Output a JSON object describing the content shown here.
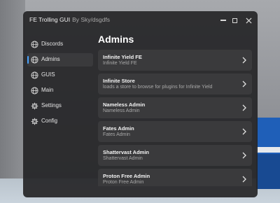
{
  "window": {
    "title": "FE Trolling GUI",
    "subtitle": "By Sky/dsgdfs"
  },
  "sidebar": {
    "items": [
      {
        "label": "Discords",
        "icon": "globe-icon",
        "active": false
      },
      {
        "label": "Admins",
        "icon": "globe-icon",
        "active": true
      },
      {
        "label": "GUIS",
        "icon": "globe-icon",
        "active": false
      },
      {
        "label": "Main",
        "icon": "globe-icon",
        "active": false
      },
      {
        "label": "Settings",
        "icon": "gear-icon",
        "active": false
      },
      {
        "label": "Config",
        "icon": "gear-icon",
        "active": false
      }
    ]
  },
  "main": {
    "title": "Admins",
    "cards": [
      {
        "title": "Infinite Yield FE",
        "desc": "Infinite Yield FE"
      },
      {
        "title": "Infinite Store",
        "desc": "loads a store to browse for plugins for Infinite Yield"
      },
      {
        "title": "Nameless Admin",
        "desc": "Nameless Admin"
      },
      {
        "title": "Fates Admin",
        "desc": "Fates Admin"
      },
      {
        "title": "Shattervast Admin",
        "desc": "Shattervast Admin"
      },
      {
        "title": "Proton Free Admin",
        "desc": "Proton Free Admin"
      }
    ]
  },
  "colors": {
    "window_bg": "#262628",
    "card_bg": "#3a3a3c",
    "accent": "#4aa3ff"
  }
}
